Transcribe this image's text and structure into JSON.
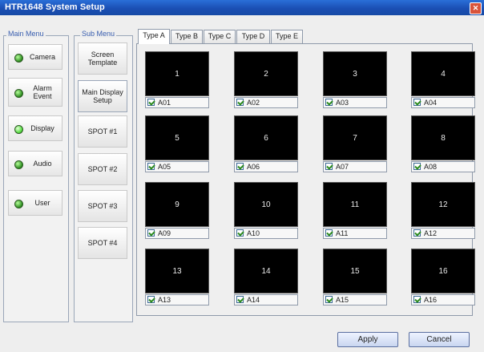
{
  "window": {
    "title": "HTR1648 System Setup",
    "close_icon": "close-icon"
  },
  "main_menu": {
    "label": "Main Menu",
    "items": [
      {
        "label": "Camera",
        "led": "on"
      },
      {
        "label": "Alarm\nEvent",
        "led": "off"
      },
      {
        "label": "Display",
        "led": "active"
      },
      {
        "label": "Audio",
        "led": "off"
      },
      {
        "label": "User",
        "led": "off"
      }
    ]
  },
  "sub_menu": {
    "label": "Sub Menu",
    "items": [
      {
        "label": "Screen\nTemplate"
      },
      {
        "label": "Main Display\nSetup"
      },
      {
        "label": "SPOT #1"
      },
      {
        "label": "SPOT #2"
      },
      {
        "label": "SPOT #3"
      },
      {
        "label": "SPOT #4"
      }
    ]
  },
  "tabs": [
    {
      "label": "Type A",
      "active": true
    },
    {
      "label": "Type B",
      "active": false
    },
    {
      "label": "Type C",
      "active": false
    },
    {
      "label": "Type D",
      "active": false
    },
    {
      "label": "Type E",
      "active": false
    }
  ],
  "grid": [
    {
      "number": "1",
      "label": "A01",
      "checked": true
    },
    {
      "number": "2",
      "label": "A02",
      "checked": true
    },
    {
      "number": "3",
      "label": "A03",
      "checked": true
    },
    {
      "number": "4",
      "label": "A04",
      "checked": true
    },
    {
      "number": "5",
      "label": "A05",
      "checked": true
    },
    {
      "number": "6",
      "label": "A06",
      "checked": true
    },
    {
      "number": "7",
      "label": "A07",
      "checked": true
    },
    {
      "number": "8",
      "label": "A08",
      "checked": true
    },
    {
      "number": "9",
      "label": "A09",
      "checked": true
    },
    {
      "number": "10",
      "label": "A10",
      "checked": true
    },
    {
      "number": "11",
      "label": "A11",
      "checked": true
    },
    {
      "number": "12",
      "label": "A12",
      "checked": true
    },
    {
      "number": "13",
      "label": "A13",
      "checked": true
    },
    {
      "number": "14",
      "label": "A14",
      "checked": true
    },
    {
      "number": "15",
      "label": "A15",
      "checked": true
    },
    {
      "number": "16",
      "label": "A16",
      "checked": true
    }
  ],
  "buttons": {
    "apply": "Apply",
    "cancel": "Cancel"
  }
}
